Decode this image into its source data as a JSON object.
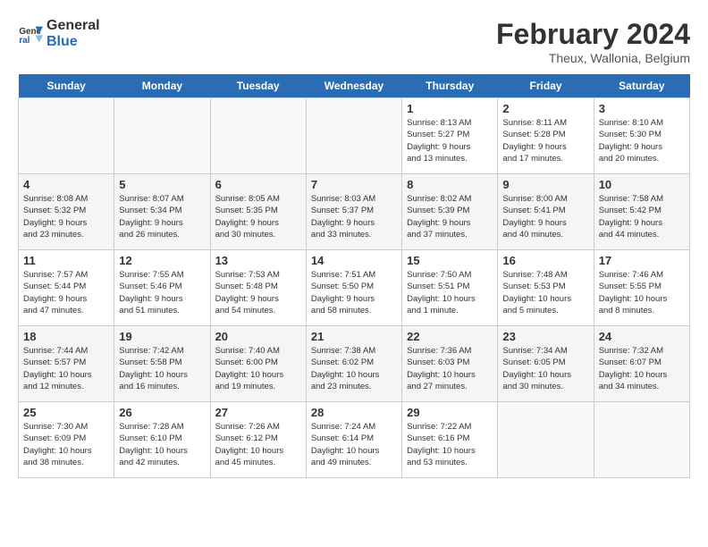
{
  "header": {
    "logo_line1": "General",
    "logo_line2": "Blue",
    "month_year": "February 2024",
    "location": "Theux, Wallonia, Belgium"
  },
  "days_of_week": [
    "Sunday",
    "Monday",
    "Tuesday",
    "Wednesday",
    "Thursday",
    "Friday",
    "Saturday"
  ],
  "weeks": [
    [
      {
        "day": "",
        "info": ""
      },
      {
        "day": "",
        "info": ""
      },
      {
        "day": "",
        "info": ""
      },
      {
        "day": "",
        "info": ""
      },
      {
        "day": "1",
        "info": "Sunrise: 8:13 AM\nSunset: 5:27 PM\nDaylight: 9 hours\nand 13 minutes."
      },
      {
        "day": "2",
        "info": "Sunrise: 8:11 AM\nSunset: 5:28 PM\nDaylight: 9 hours\nand 17 minutes."
      },
      {
        "day": "3",
        "info": "Sunrise: 8:10 AM\nSunset: 5:30 PM\nDaylight: 9 hours\nand 20 minutes."
      }
    ],
    [
      {
        "day": "4",
        "info": "Sunrise: 8:08 AM\nSunset: 5:32 PM\nDaylight: 9 hours\nand 23 minutes."
      },
      {
        "day": "5",
        "info": "Sunrise: 8:07 AM\nSunset: 5:34 PM\nDaylight: 9 hours\nand 26 minutes."
      },
      {
        "day": "6",
        "info": "Sunrise: 8:05 AM\nSunset: 5:35 PM\nDaylight: 9 hours\nand 30 minutes."
      },
      {
        "day": "7",
        "info": "Sunrise: 8:03 AM\nSunset: 5:37 PM\nDaylight: 9 hours\nand 33 minutes."
      },
      {
        "day": "8",
        "info": "Sunrise: 8:02 AM\nSunset: 5:39 PM\nDaylight: 9 hours\nand 37 minutes."
      },
      {
        "day": "9",
        "info": "Sunrise: 8:00 AM\nSunset: 5:41 PM\nDaylight: 9 hours\nand 40 minutes."
      },
      {
        "day": "10",
        "info": "Sunrise: 7:58 AM\nSunset: 5:42 PM\nDaylight: 9 hours\nand 44 minutes."
      }
    ],
    [
      {
        "day": "11",
        "info": "Sunrise: 7:57 AM\nSunset: 5:44 PM\nDaylight: 9 hours\nand 47 minutes."
      },
      {
        "day": "12",
        "info": "Sunrise: 7:55 AM\nSunset: 5:46 PM\nDaylight: 9 hours\nand 51 minutes."
      },
      {
        "day": "13",
        "info": "Sunrise: 7:53 AM\nSunset: 5:48 PM\nDaylight: 9 hours\nand 54 minutes."
      },
      {
        "day": "14",
        "info": "Sunrise: 7:51 AM\nSunset: 5:50 PM\nDaylight: 9 hours\nand 58 minutes."
      },
      {
        "day": "15",
        "info": "Sunrise: 7:50 AM\nSunset: 5:51 PM\nDaylight: 10 hours\nand 1 minute."
      },
      {
        "day": "16",
        "info": "Sunrise: 7:48 AM\nSunset: 5:53 PM\nDaylight: 10 hours\nand 5 minutes."
      },
      {
        "day": "17",
        "info": "Sunrise: 7:46 AM\nSunset: 5:55 PM\nDaylight: 10 hours\nand 8 minutes."
      }
    ],
    [
      {
        "day": "18",
        "info": "Sunrise: 7:44 AM\nSunset: 5:57 PM\nDaylight: 10 hours\nand 12 minutes."
      },
      {
        "day": "19",
        "info": "Sunrise: 7:42 AM\nSunset: 5:58 PM\nDaylight: 10 hours\nand 16 minutes."
      },
      {
        "day": "20",
        "info": "Sunrise: 7:40 AM\nSunset: 6:00 PM\nDaylight: 10 hours\nand 19 minutes."
      },
      {
        "day": "21",
        "info": "Sunrise: 7:38 AM\nSunset: 6:02 PM\nDaylight: 10 hours\nand 23 minutes."
      },
      {
        "day": "22",
        "info": "Sunrise: 7:36 AM\nSunset: 6:03 PM\nDaylight: 10 hours\nand 27 minutes."
      },
      {
        "day": "23",
        "info": "Sunrise: 7:34 AM\nSunset: 6:05 PM\nDaylight: 10 hours\nand 30 minutes."
      },
      {
        "day": "24",
        "info": "Sunrise: 7:32 AM\nSunset: 6:07 PM\nDaylight: 10 hours\nand 34 minutes."
      }
    ],
    [
      {
        "day": "25",
        "info": "Sunrise: 7:30 AM\nSunset: 6:09 PM\nDaylight: 10 hours\nand 38 minutes."
      },
      {
        "day": "26",
        "info": "Sunrise: 7:28 AM\nSunset: 6:10 PM\nDaylight: 10 hours\nand 42 minutes."
      },
      {
        "day": "27",
        "info": "Sunrise: 7:26 AM\nSunset: 6:12 PM\nDaylight: 10 hours\nand 45 minutes."
      },
      {
        "day": "28",
        "info": "Sunrise: 7:24 AM\nSunset: 6:14 PM\nDaylight: 10 hours\nand 49 minutes."
      },
      {
        "day": "29",
        "info": "Sunrise: 7:22 AM\nSunset: 6:16 PM\nDaylight: 10 hours\nand 53 minutes."
      },
      {
        "day": "",
        "info": ""
      },
      {
        "day": "",
        "info": ""
      }
    ]
  ]
}
